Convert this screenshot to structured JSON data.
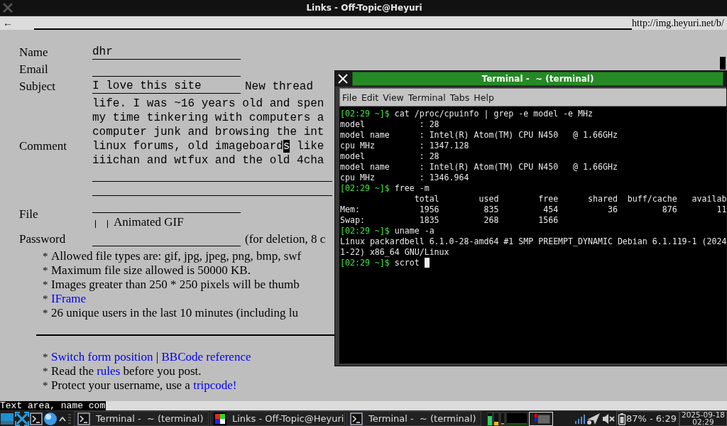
{
  "browser": {
    "title": "Links - Off-Topic@Heyuri",
    "back": "←",
    "url": "http://img.heyuri.net/b/",
    "form": [
      {
        "kind": "text",
        "label": "Name",
        "value": "dhr"
      },
      {
        "kind": "text",
        "label": "Email"
      },
      {
        "kind": "subject",
        "label": "Subject",
        "value": "I love this site",
        "button": "New thread"
      },
      {
        "kind": "textarea",
        "label": "Comment",
        "lines": [
          {
            "text": "life. I was ~16 years old and spen"
          },
          {
            "text": "my time tinkering with computers a"
          },
          {
            "text": "computer junk and browsing the int"
          },
          {
            "before": "linux forums, old imageboard",
            "cursor": "s",
            "after": " like"
          },
          {
            "text": "iiichan and wtfux and the old 4cha"
          }
        ]
      },
      {
        "kind": "file",
        "label": "File",
        "checkbox": {
          "label": "Animated GIF",
          "checked": false
        }
      },
      {
        "kind": "password",
        "label": "Password",
        "note": "(for deletion, 8 c"
      }
    ],
    "notes": [
      {
        "bullet": "*",
        "parts": [
          {
            "kind": "text",
            "text": "Allowed file types are: gif, jpg, jpeg, png, bmp, swf"
          }
        ]
      },
      {
        "bullet": "*",
        "parts": [
          {
            "kind": "text",
            "text": "Maximum file size allowed is 50000 KB."
          }
        ]
      },
      {
        "bullet": "*",
        "parts": [
          {
            "kind": "text",
            "text": "Images greater than 250 * 250 pixels will be thumb"
          }
        ]
      },
      {
        "bullet": "*",
        "parts": [
          {
            "kind": "link",
            "text": "IFrame"
          }
        ]
      },
      {
        "bullet": "*",
        "parts": [
          {
            "kind": "text",
            "text": "26 unique users in the last 10 minutes (including lu"
          }
        ]
      }
    ],
    "footer_notes": [
      {
        "bullet": "*",
        "parts": [
          {
            "kind": "link",
            "text": "Switch form position"
          },
          {
            "kind": "text",
            "text": " | "
          },
          {
            "kind": "link",
            "text": "BBCode reference"
          }
        ]
      },
      {
        "bullet": "*",
        "parts": [
          {
            "kind": "text",
            "text": "Read the "
          },
          {
            "kind": "link",
            "text": "rules"
          },
          {
            "kind": "text",
            "text": " before you post."
          }
        ]
      },
      {
        "bullet": "*",
        "parts": [
          {
            "kind": "text",
            "text": "Protect your username, use a "
          },
          {
            "kind": "link",
            "text": "tripcode!"
          }
        ]
      }
    ],
    "status_line": "Text area, name com"
  },
  "terminal": {
    "title": "Terminal -  ~ (terminal)",
    "menu": [
      "File",
      "Edit",
      "View",
      "Terminal",
      "Tabs",
      "Help"
    ],
    "lines": [
      {
        "kind": "prompt",
        "prompt": "[02:29 ~]$",
        "command": "cat /proc/cpuinfo | grep -e model -e MHz"
      },
      {
        "kind": "output",
        "text": "model           : 28"
      },
      {
        "kind": "output",
        "text": "model name      : Intel(R) Atom(TM) CPU N450   @ 1.66GHz"
      },
      {
        "kind": "output",
        "text": "cpu MHz         : 1347.128"
      },
      {
        "kind": "output",
        "text": "model           : 28"
      },
      {
        "kind": "output",
        "text": "model name      : Intel(R) Atom(TM) CPU N450   @ 1.66GHz"
      },
      {
        "kind": "output",
        "text": "cpu MHz         : 1346.964"
      },
      {
        "kind": "prompt",
        "prompt": "[02:29 ~]$",
        "command": "free -m"
      },
      {
        "kind": "output",
        "text": "               total        used        free      shared  buff/cache   availab"
      },
      {
        "kind": "output",
        "text": "Mem:            1956         835         454          36         876        11"
      },
      {
        "kind": "output",
        "text": "Swap:           1835         268        1566"
      },
      {
        "kind": "prompt",
        "prompt": "[02:29 ~]$",
        "command": "uname -a"
      },
      {
        "kind": "output",
        "text": "Linux packardbell 6.1.0-28-amd64 #1 SMP PREEMPT_DYNAMIC Debian 6.1.119-1 (2024"
      },
      {
        "kind": "output",
        "text": "1-22) x86_64 GNU/Linux"
      },
      {
        "kind": "prompt",
        "prompt": "[02:29 ~]$",
        "command": "scrot",
        "cursor": true
      }
    ]
  },
  "taskbar": {
    "tasks": [
      {
        "kind": "terminal",
        "title": "Terminal -  ~ (terminal)"
      },
      {
        "kind": "links",
        "title": "Links - Off-Topic@Heyuri"
      },
      {
        "kind": "terminal",
        "title": "Terminal -  ~ (terminal)"
      }
    ],
    "battery": "87% - 6:29",
    "date": "2025-09-18",
    "time": "02:29"
  }
}
